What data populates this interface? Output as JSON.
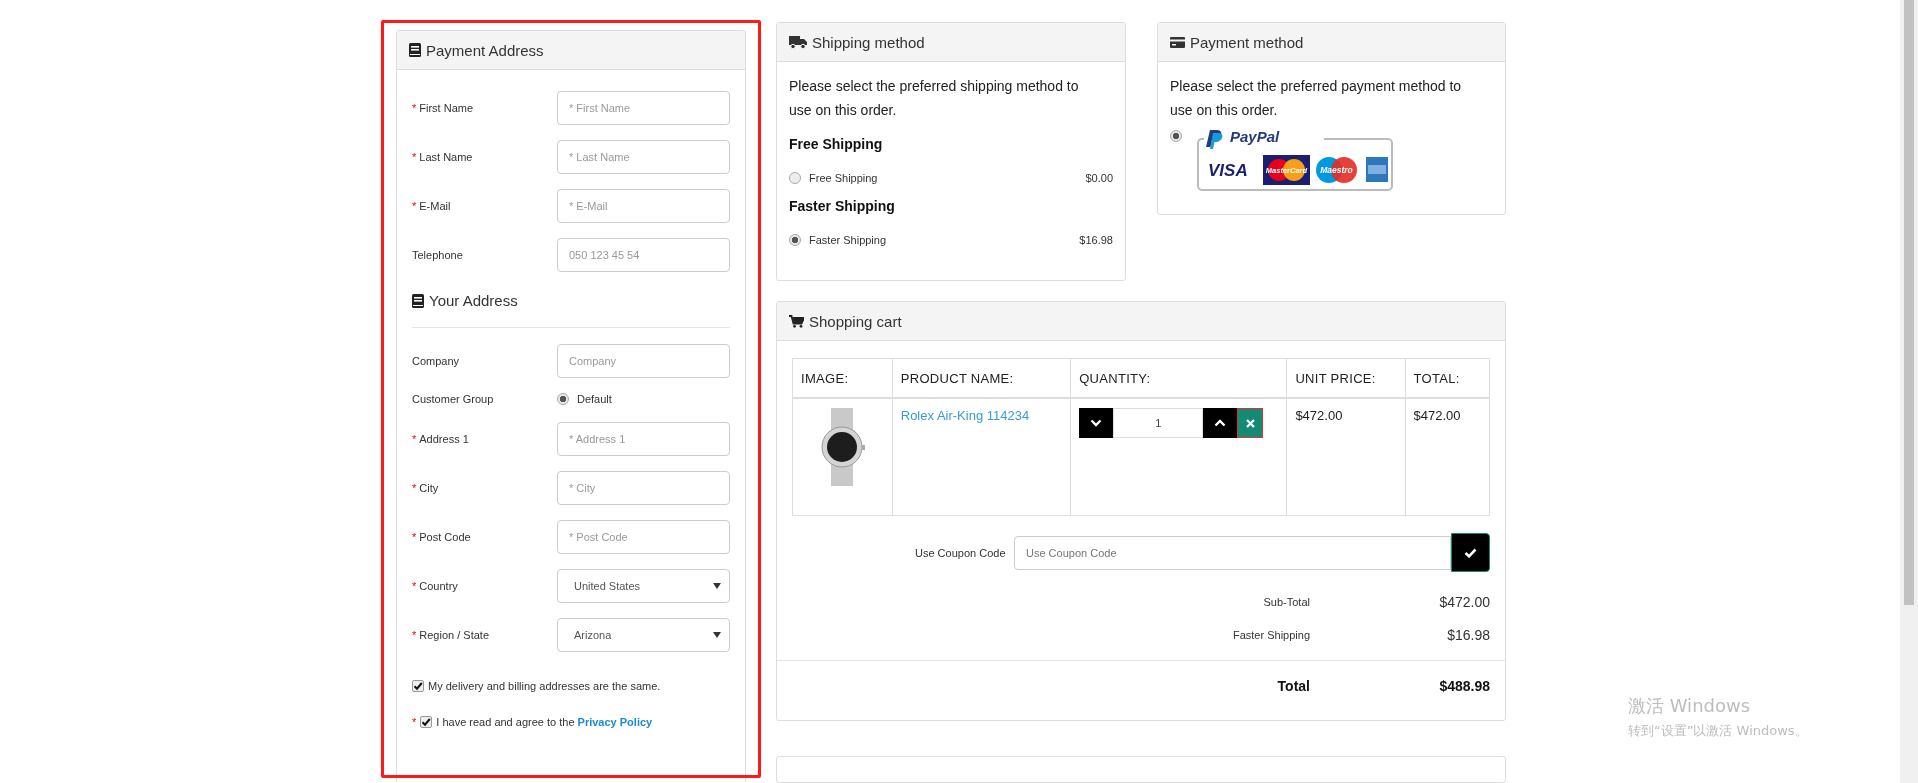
{
  "required_mark": "*",
  "payment_address": {
    "title": "Payment Address",
    "fields": [
      {
        "kind": "input",
        "label": "First Name",
        "required": true,
        "placeholder": "* First Name"
      },
      {
        "kind": "input",
        "label": "Last Name",
        "required": true,
        "placeholder": "* Last Name"
      },
      {
        "kind": "input",
        "label": "E-Mail",
        "required": true,
        "placeholder": "* E-Mail"
      },
      {
        "kind": "input",
        "label": "Telephone",
        "required": false,
        "placeholder": "050 123 45 54"
      }
    ],
    "address_title": "Your Address",
    "address_fields": [
      {
        "kind": "input",
        "label": "Company",
        "required": false,
        "placeholder": "Company"
      },
      {
        "kind": "radio",
        "label": "Customer Group",
        "required": false,
        "options": [
          {
            "label": "Default",
            "selected": true
          }
        ]
      },
      {
        "kind": "input",
        "label": "Address 1",
        "required": true,
        "placeholder": "* Address 1"
      },
      {
        "kind": "input",
        "label": "City",
        "required": true,
        "placeholder": "* City"
      },
      {
        "kind": "input",
        "label": "Post Code",
        "required": true,
        "placeholder": "* Post Code"
      },
      {
        "kind": "select",
        "label": "Country",
        "required": true,
        "value": "United States"
      },
      {
        "kind": "select",
        "label": "Region / State",
        "required": true,
        "value": "Arizona"
      }
    ],
    "checkboxes": [
      {
        "text": "My delivery and billing addresses are the same.",
        "checked": true,
        "required": false
      },
      {
        "text": "I have read and agree to the",
        "link": "Privacy Policy",
        "checked": true,
        "required": true
      }
    ]
  },
  "shipping_method": {
    "title": "Shipping method",
    "description": "Please select the preferred shipping method to use on this order.",
    "groups": [
      {
        "title": "Free Shipping",
        "options": [
          {
            "label": "Free Shipping",
            "price": "$0.00",
            "selected": false
          }
        ]
      },
      {
        "title": "Faster Shipping",
        "options": [
          {
            "label": "Faster Shipping",
            "price": "$16.98",
            "selected": true
          }
        ]
      }
    ]
  },
  "payment_method": {
    "title": "Payment method",
    "description": "Please select the preferred payment method to use on this order.",
    "options": [
      {
        "selected": true,
        "logo_texts": [
          "PayPal",
          "VISA",
          "MasterCard",
          "Maestro"
        ]
      }
    ]
  },
  "shopping_cart": {
    "title": "Shopping cart",
    "columns": [
      "IMAGE:",
      "PRODUCT NAME:",
      "QUANTITY:",
      "UNIT PRICE:",
      "TOTAL:"
    ],
    "rows": [
      {
        "product": "Rolex Air-King 114234",
        "quantity": "1",
        "unit_price": "$472.00",
        "total": "$472.00"
      }
    ],
    "coupon": {
      "label": "Use Coupon Code",
      "placeholder": "Use Coupon Code"
    },
    "totals": [
      {
        "label": "Sub-Total",
        "value": "$472.00"
      },
      {
        "label": "Faster Shipping",
        "value": "$16.98"
      }
    ],
    "grand_total": {
      "label": "Total",
      "value": "$488.98"
    }
  },
  "os_notice": {
    "title": "激活 Windows",
    "subtitle": "转到“设置”以激活 Windows。"
  }
}
